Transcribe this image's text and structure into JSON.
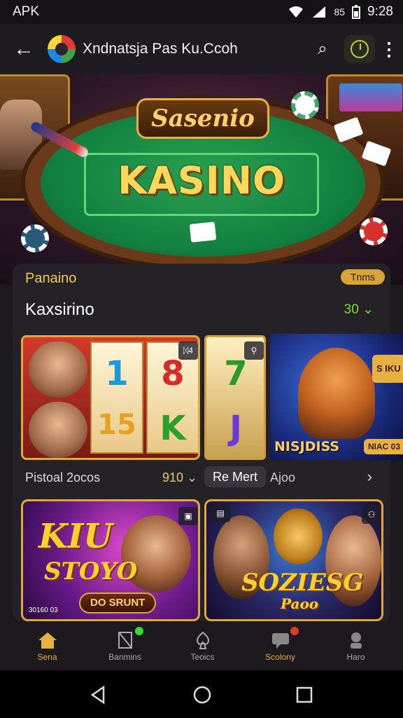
{
  "status": {
    "left": "APK",
    "battery": "85",
    "time": "9:28"
  },
  "appbar": {
    "title": "Xndnatsja Pas Ku.Ccoh"
  },
  "hero": {
    "brand": "Sasenio",
    "title": "KASINO"
  },
  "panel": {
    "category": "Panaino",
    "badge": "Tnms",
    "name": "Kaxsirino",
    "count": "30 ⌄"
  },
  "slots": {
    "tag1": "ᛞ4",
    "tag2": "⚲",
    "symbols": [
      "1",
      "8",
      "15",
      "K",
      "7",
      "J"
    ],
    "game3_label": "NISJDISS",
    "game3_side": "S IKU",
    "game3_side2": "NIAC 03"
  },
  "row": {
    "label": "Pistoal 2ocos",
    "number": "910 ⌄",
    "pill": "Re Mert",
    "extra": "Ajoo"
  },
  "games": [
    {
      "title_a": "KIU",
      "title_b": "STOYO",
      "button": "DO SRUNT",
      "corner": "30160 03"
    },
    {
      "title_a": "SOZIESG",
      "title_b": "Paoo"
    }
  ],
  "tabs": [
    {
      "label": "Sena"
    },
    {
      "label": "Banmins"
    },
    {
      "label": "Teoics"
    },
    {
      "label": "Scolony"
    },
    {
      "label": "Haro"
    }
  ],
  "colors": {
    "accent": "#e8b040",
    "green": "#7cdc3a",
    "background": "#1c1a1f"
  }
}
